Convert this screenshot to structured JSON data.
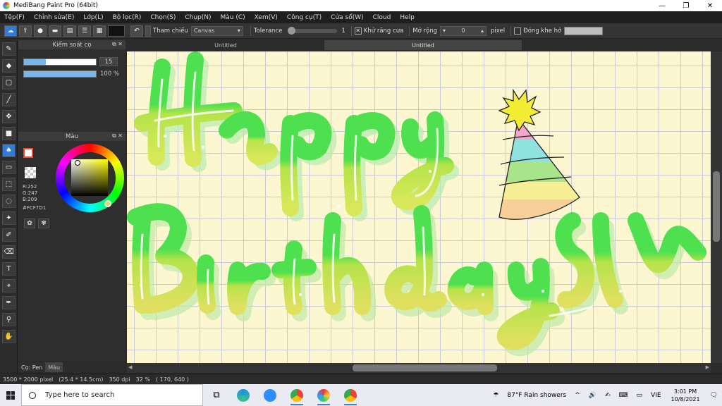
{
  "window": {
    "title": "MediBang Paint Pro (64bit)",
    "minimize": "—",
    "maximize": "❐",
    "close": "✕"
  },
  "menu": [
    "Tệp(F)",
    "Chỉnh sửa(E)",
    "Lớp(L)",
    "Bộ lọc(R)",
    "Chọn(S)",
    "Chụp(N)",
    "Màu (C)",
    "Xem(V)",
    "Công cụ(T)",
    "Cửa sổ(W)",
    "Cloud",
    "Help"
  ],
  "toolbar": {
    "reference_label": "Tham chiếu",
    "reference_value": "Canvas",
    "tolerance_label": "Tolerance",
    "tolerance_value": "1",
    "antialias_label": "Khử răng cưa",
    "antialias_checked": "✕",
    "expand_label": "Mở rộng",
    "expand_value": "0",
    "expand_unit": "pixel",
    "close_gap_label": "Đóng khe hở"
  },
  "brush_panel": {
    "title": "Kiểm soát cọ",
    "size_value": "15",
    "size_fraction": 0.3,
    "opacity_value": "100 %",
    "opacity_fraction": 1.0
  },
  "color_panel": {
    "title": "Màu",
    "r": "R:252",
    "g": "G:247",
    "b": "B:209",
    "hex": "#FCF7D1",
    "foreground": "#f04a2c",
    "background": "#fcf7d1"
  },
  "bottom_tabs": [
    "Cọ: Pen",
    "Màu"
  ],
  "doc_tabs": [
    "Untitled",
    "Untitled"
  ],
  "status": {
    "size": "3500 * 2000 pixel",
    "cm": "(25.4 * 14.5cm)",
    "dpi": "350 dpi",
    "zoom": "32 %",
    "coords": "( 170, 640 )"
  },
  "taskbar": {
    "search_placeholder": "Type here to search",
    "weather": "87°F  Rain showers",
    "lang": "VIE",
    "time": "3:01 PM",
    "date": "10/8/2021"
  },
  "icons": {
    "tools": [
      "brush-icon",
      "eraser-icon",
      "rect-select-icon",
      "line-icon",
      "move-icon",
      "fill-rect-icon",
      "bucket-icon",
      "gradient-icon",
      "lasso-icon",
      "dotted-select-icon",
      "magic-wand-icon",
      "select-pen-icon",
      "select-eraser-icon",
      "text-icon",
      "operation-icon",
      "pipette-icon",
      "eyedropper-icon",
      "hand-icon"
    ]
  }
}
